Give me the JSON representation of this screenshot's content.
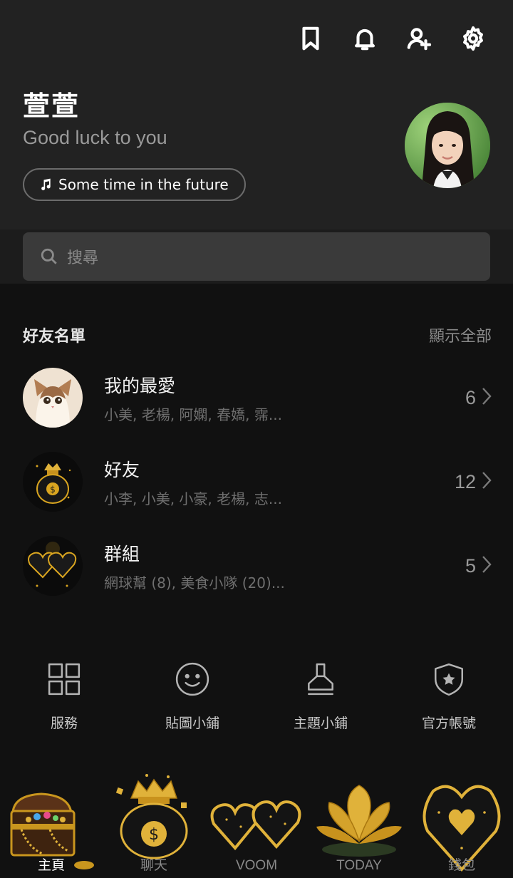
{
  "header": {
    "icons": [
      "bookmark-icon",
      "bell-icon",
      "add-friend-icon",
      "gear-icon"
    ]
  },
  "profile": {
    "name": "萱萱",
    "status": "Good luck to you",
    "music": "Some time in the future"
  },
  "search": {
    "placeholder": "搜尋"
  },
  "friends_section": {
    "title": "好友名單",
    "show_all": "顯示全部",
    "rows": [
      {
        "title": "我的最愛",
        "members": "小美, 老楊, 阿嫻, 春嬌, 霈...",
        "count": "6"
      },
      {
        "title": "好友",
        "members": "小李, 小美, 小豪, 老楊, 志...",
        "count": "12"
      },
      {
        "title": "群組",
        "members": "網球幫 (8), 美食小隊 (20)...",
        "count": "5"
      }
    ]
  },
  "quick_links": [
    {
      "label": "服務",
      "icon": "grid-icon"
    },
    {
      "label": "貼圖小鋪",
      "icon": "smiley-icon"
    },
    {
      "label": "主題小鋪",
      "icon": "brush-icon"
    },
    {
      "label": "官方帳號",
      "icon": "shield-star-icon"
    }
  ],
  "nav": {
    "items": [
      {
        "label": "主頁",
        "icon": "treasure-chest-icon"
      },
      {
        "label": "聊天",
        "icon": "money-bag-icon"
      },
      {
        "label": "VOOM",
        "icon": "double-heart-icon"
      },
      {
        "label": "TODAY",
        "icon": "gold-lotus-icon"
      },
      {
        "label": "錢包",
        "icon": "gold-heart-icon"
      }
    ]
  },
  "colors": {
    "background": "#111111",
    "header_bg": "#222222",
    "gold": "#d9a520",
    "muted_text": "#8a8a8a"
  }
}
